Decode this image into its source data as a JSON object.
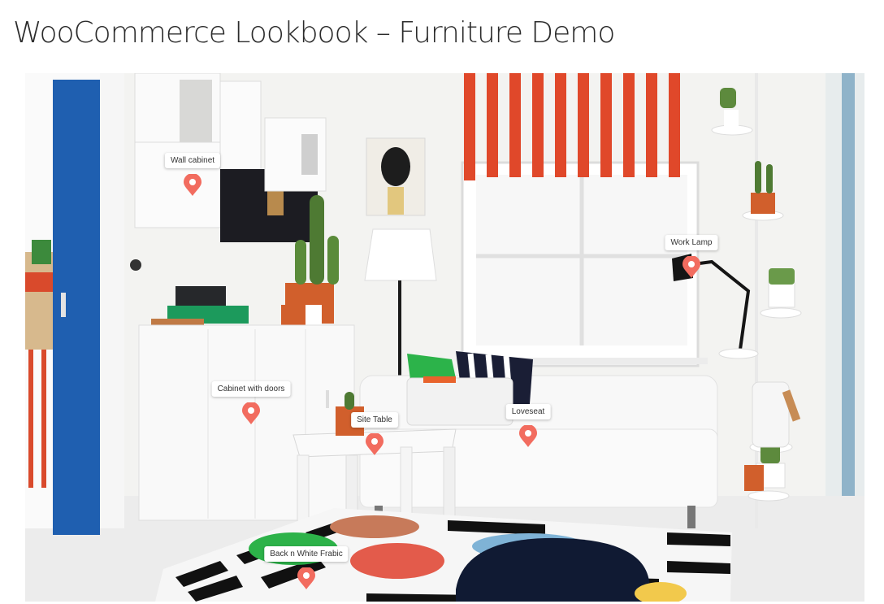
{
  "page": {
    "title": "WooCommerce Lookbook – Furniture Demo"
  },
  "hotspots": [
    {
      "id": "wall-cabinet",
      "label": "Wall cabinet"
    },
    {
      "id": "work-lamp",
      "label": "Work Lamp"
    },
    {
      "id": "cabinet-with-doors",
      "label": "Cabinet with doors"
    },
    {
      "id": "site-table",
      "label": "Site Table"
    },
    {
      "id": "loveseat",
      "label": "Loveseat"
    },
    {
      "id": "rug",
      "label": "Back n White Frabic"
    }
  ],
  "colors": {
    "pin": "#f26c5f",
    "label_bg": "#ffffff",
    "title": "#2b2b2b"
  }
}
